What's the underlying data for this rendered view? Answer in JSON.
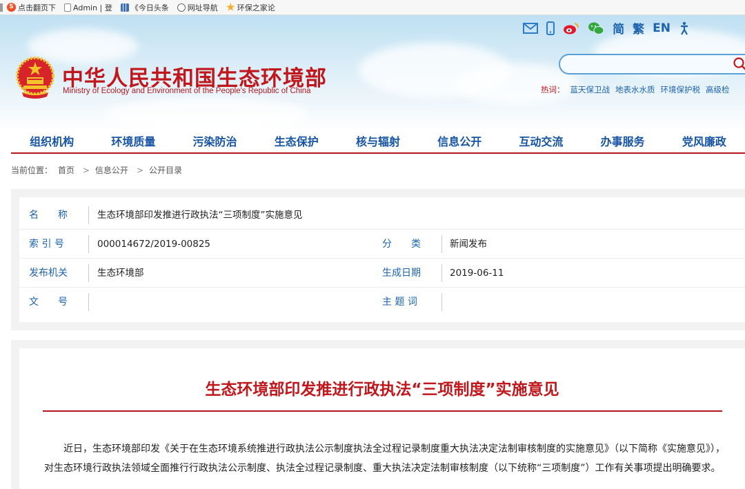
{
  "bookmarks": [
    {
      "icon": "tab-edge-icon",
      "label": "",
      "type": "none"
    },
    {
      "icon": "sogou-icon",
      "label": "点击翻页下",
      "type": "s"
    },
    {
      "icon": "page-icon",
      "label": "Admin | 登",
      "type": "doc"
    },
    {
      "icon": "toutiao-icon",
      "label": "《今日头条",
      "type": "bars"
    },
    {
      "icon": "globe-icon",
      "label": "网址导航",
      "type": "globe"
    },
    {
      "icon": "star-icon",
      "label": "环保之家论",
      "type": "star"
    }
  ],
  "top_icons": {
    "mail": "mail-icon",
    "mobile": "mobile-icon",
    "weibo": "weibo-icon",
    "wechat": "wechat-icon",
    "simplified": "简",
    "traditional": "繁",
    "english": "EN",
    "accessibility": "accessibility-icon"
  },
  "site": {
    "title": "中华人民共和国生态环境部",
    "subtitle": "Ministry of Ecology and Environment of the People's Republic of China"
  },
  "search": {
    "value": "",
    "placeholder": ""
  },
  "hot": {
    "label": "热词：",
    "links": [
      "蓝天保卫战",
      "地表水水质",
      "环境保护税",
      "高级检"
    ]
  },
  "nav": [
    "组织机构",
    "环境质量",
    "污染防治",
    "生态保护",
    "核与辐射",
    "信息公开",
    "互动交流",
    "办事服务",
    "党风廉政"
  ],
  "breadcrumb": {
    "label": "当前位置：",
    "items": [
      "首页",
      "信息公开",
      "公开目录"
    ],
    "separator": ">"
  },
  "meta": {
    "name_label": "名　　称",
    "name_value": "生态环境部印发推进行政执法“三项制度”实施意见",
    "index_label": "索 引 号",
    "index_value": "000014672/2019-00825",
    "category_label": "分　　类",
    "category_value": "新闻发布",
    "publisher_label": "发布机关",
    "publisher_value": "生态环境部",
    "date_label": "生成日期",
    "date_value": "2019-06-11",
    "docno_label": "文　　号",
    "docno_value": "",
    "keywords_label": "主 题 词",
    "keywords_value": ""
  },
  "article": {
    "title": "生态环境部印发推进行政执法“三项制度”实施意见",
    "body": "近日，生态环境部印发《关于在生态环境系统推进行政执法公示制度执法全过程记录制度重大执法决定法制审核制度的实施意见》（以下简称《实施意见》），对生态环境行政执法领域全面推行行政执法公示制度、执法全过程记录制度、重大执法决定法制审核制度（以下统称“三项制度”）工作有关事项提出明确要求。"
  },
  "colors": {
    "brand_red": "#c0171d",
    "nav_blue": "#1553a3",
    "link_blue": "#1d63ad"
  }
}
